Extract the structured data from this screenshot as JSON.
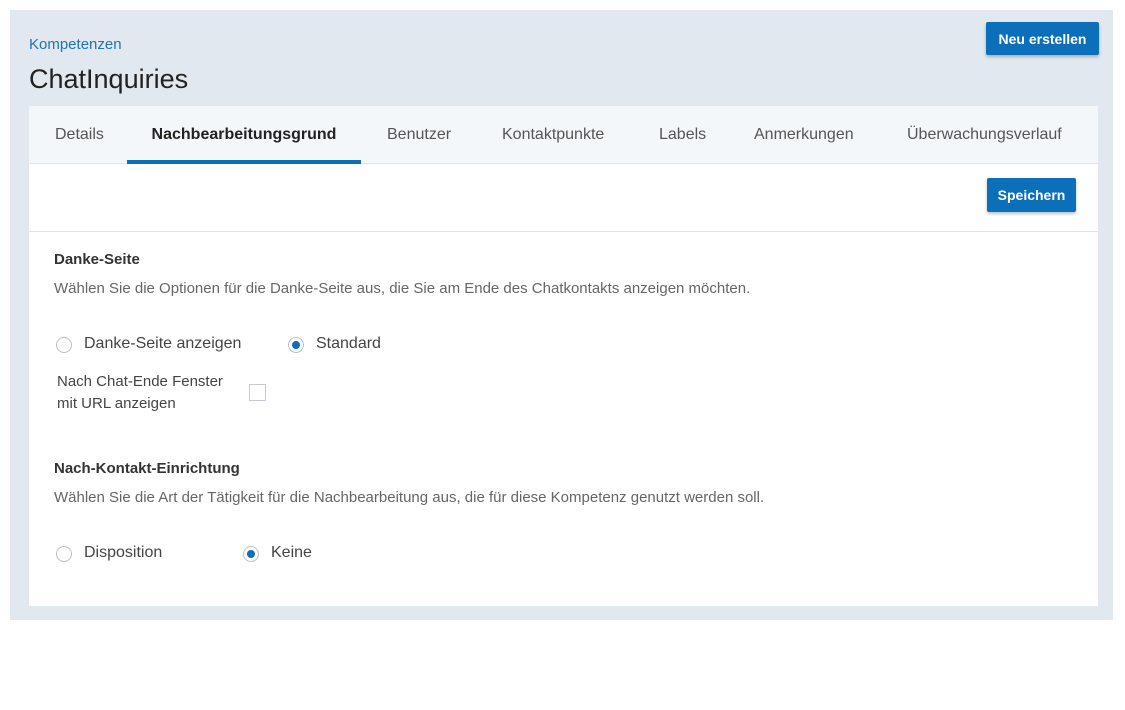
{
  "header": {
    "breadcrumb": "Kompetenzen",
    "title": "ChatInquiries",
    "new_button_label": "Neu erstellen"
  },
  "tabs": [
    {
      "label": "Details",
      "active": false
    },
    {
      "label": "Nachbearbeitungsgrund",
      "active": true
    },
    {
      "label": "Benutzer",
      "active": false
    },
    {
      "label": "Kontaktpunkte",
      "active": false
    },
    {
      "label": "Labels",
      "active": false
    },
    {
      "label": "Anmerkungen",
      "active": false
    },
    {
      "label": "Überwachungsverlauf",
      "active": false
    }
  ],
  "toolbar": {
    "save_label": "Speichern"
  },
  "thank_you_page": {
    "title": "Danke-Seite",
    "description": "Wählen Sie die Optionen für die Danke-Seite aus, die Sie am Ende des Chatkontakts anzeigen möchten.",
    "options": [
      {
        "label": "Danke-Seite anzeigen",
        "selected": false
      },
      {
        "label": "Standard",
        "selected": true
      }
    ],
    "url_window_label": "Nach Chat-Ende Fenster mit URL anzeigen",
    "url_window_checked": false
  },
  "post_contact": {
    "title": "Nach-Kontakt-Einrichtung",
    "description": "Wählen Sie die Art der Tätigkeit für die Nachbearbeitung aus, die für diese Kompetenz genutzt werden soll.",
    "options": [
      {
        "label": "Disposition",
        "selected": false
      },
      {
        "label": "Keine",
        "selected": true
      }
    ]
  },
  "colors": {
    "accent": "#0b6fb9",
    "frame_background": "#e1e8f0",
    "link": "#1f74b5"
  }
}
